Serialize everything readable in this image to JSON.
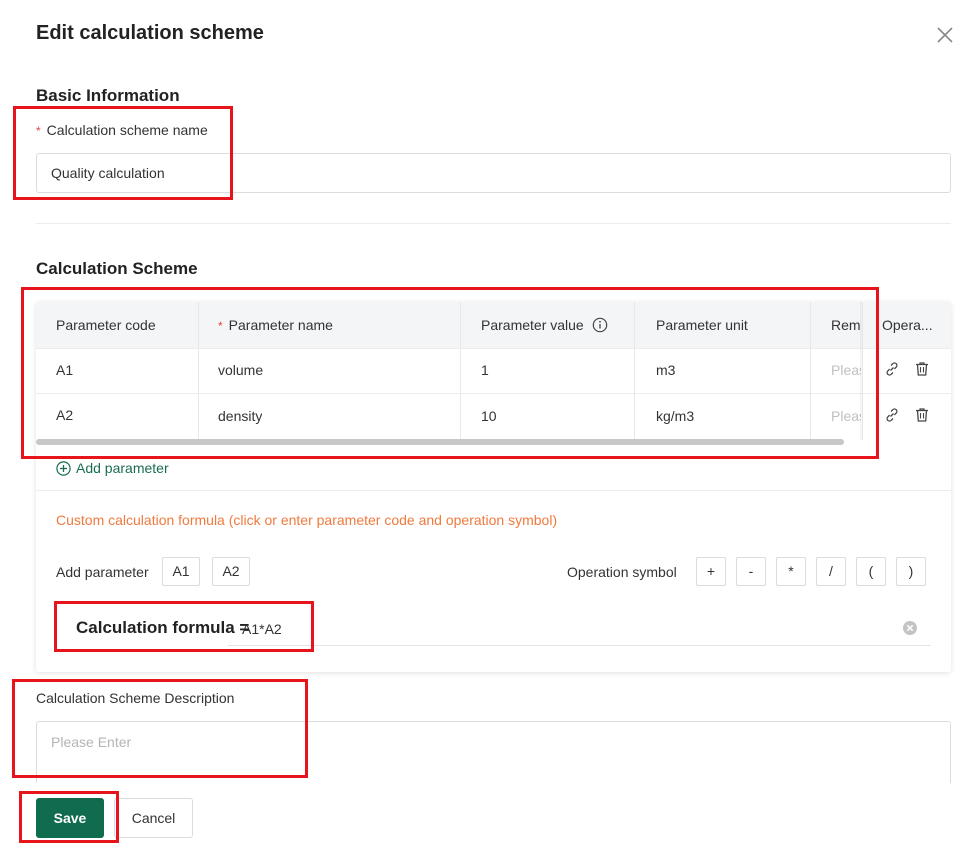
{
  "dialog": {
    "title": "Edit calculation scheme"
  },
  "basic_info": {
    "section_title": "Basic Information",
    "name_label": "Calculation scheme name",
    "required_mark": "*",
    "name_value": "Quality calculation"
  },
  "scheme": {
    "section_title": "Calculation Scheme",
    "columns": {
      "code": "Parameter code",
      "name": "Parameter name",
      "value": "Parameter value",
      "unit": "Parameter unit",
      "remark": "Rema",
      "operation": "Opera..."
    },
    "rows": [
      {
        "code": "A1",
        "name": "volume",
        "value": "1",
        "unit": "m3",
        "remark_placeholder": "Pleas"
      },
      {
        "code": "A2",
        "name": "density",
        "value": "10",
        "unit": "kg/m3",
        "remark_placeholder": "Pleas"
      }
    ],
    "add_parameter_link": "Add parameter",
    "custom_hint": "Custom calculation formula (click or enter parameter code and operation symbol)",
    "add_parameter_label": "Add parameter",
    "param_chips": [
      "A1",
      "A2"
    ],
    "operation_label": "Operation symbol",
    "op_chips": [
      "+",
      "-",
      "*",
      "/",
      "(",
      ")"
    ],
    "formula_label": "Calculation formula =",
    "formula_value": "A1*A2"
  },
  "description": {
    "label": "Calculation Scheme Description",
    "placeholder": "Please Enter"
  },
  "footer": {
    "save_label": "Save",
    "cancel_label": "Cancel"
  },
  "colors": {
    "primary": "#116b4e",
    "hint": "#f07a3e",
    "required": "#e0473c",
    "annotation": "#e8141b"
  }
}
